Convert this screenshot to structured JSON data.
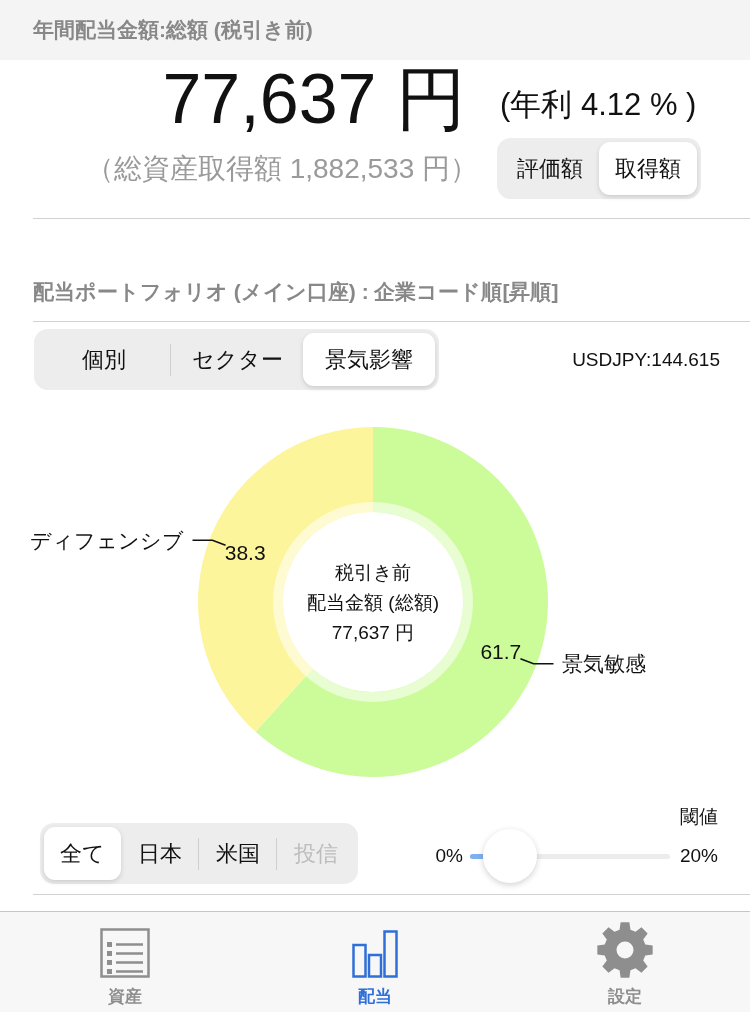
{
  "header": {
    "title": "年間配当金額:総額 (税引き前)"
  },
  "summary": {
    "amount": "77,637 円",
    "yield": "(年利 4.12 % )",
    "cost_total": "（総資産取得額 1,882,533 円）",
    "basis_toggle": [
      {
        "label": "評価額",
        "selected": false
      },
      {
        "label": "取得額",
        "selected": true
      }
    ]
  },
  "portfolio": {
    "title": "配当ポートフォリオ (メイン口座) : 企業コード順[昇順]",
    "view_tabs": [
      {
        "label": "個別",
        "selected": false
      },
      {
        "label": "セクター",
        "selected": false
      },
      {
        "label": "景気影響",
        "selected": true
      }
    ],
    "exchange_rate": "USDJPY:144.615",
    "chart": {
      "center_lines": [
        "税引き前",
        "配当金額 (総額)",
        "77,637 円"
      ],
      "chart_data": {
        "type": "donut",
        "categories": [
          "景気敏感",
          "ディフェンシブ"
        ],
        "values": [
          61.7,
          38.3
        ],
        "colors": [
          "#ccfb9a",
          "#fcf59c"
        ],
        "data_labels": true
      }
    },
    "region_filter": [
      {
        "label": "全て",
        "selected": true,
        "disabled": false
      },
      {
        "label": "日本",
        "selected": false,
        "disabled": false
      },
      {
        "label": "米国",
        "selected": false,
        "disabled": false
      },
      {
        "label": "投信",
        "selected": false,
        "disabled": true
      }
    ],
    "threshold": {
      "label": "閾値",
      "min_label": "0%",
      "max_label": "20%",
      "level": 0.09
    }
  },
  "tab_bar": [
    {
      "label": "資産",
      "kind": "list",
      "selected": false
    },
    {
      "label": "配当",
      "kind": "bars",
      "selected": true
    },
    {
      "label": "設定",
      "kind": "gear",
      "selected": false
    }
  ]
}
